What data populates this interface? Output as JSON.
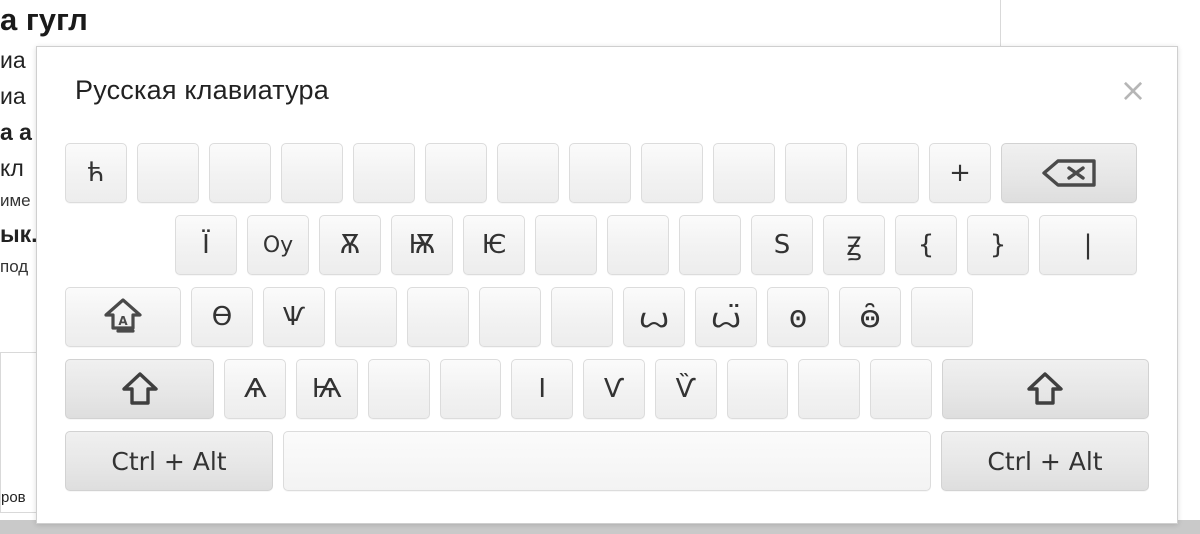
{
  "background": {
    "heading": "а гугл",
    "lines": [
      "иа",
      "иа"
    ],
    "bold_line": "а а",
    "line3": "кл",
    "line4": "имe",
    "line5": "ык.",
    "line6": "под",
    "tail": "ров",
    "links": [
      "",
      "",
      "",
      "",
      "",
      ""
    ]
  },
  "dialog": {
    "title": "Русская клавиатура",
    "close_label": "×"
  },
  "keyboard": {
    "rows": [
      {
        "name": "row-1",
        "indent": false,
        "keys": [
          {
            "label": "ћ",
            "name": "key-tshe",
            "type": "char"
          },
          {
            "label": "",
            "name": "key-blank-1",
            "type": "blank"
          },
          {
            "label": "",
            "name": "key-blank-2",
            "type": "blank"
          },
          {
            "label": "",
            "name": "key-blank-3",
            "type": "blank"
          },
          {
            "label": "",
            "name": "key-blank-4",
            "type": "blank"
          },
          {
            "label": "",
            "name": "key-blank-5",
            "type": "blank"
          },
          {
            "label": "",
            "name": "key-blank-6",
            "type": "blank"
          },
          {
            "label": "",
            "name": "key-blank-7",
            "type": "blank"
          },
          {
            "label": "",
            "name": "key-blank-8",
            "type": "blank"
          },
          {
            "label": "",
            "name": "key-blank-9",
            "type": "blank"
          },
          {
            "label": "",
            "name": "key-blank-10",
            "type": "blank"
          },
          {
            "label": "",
            "name": "key-blank-11",
            "type": "blank"
          },
          {
            "label": "+",
            "name": "key-plus",
            "type": "char"
          },
          {
            "label": "",
            "name": "key-backspace",
            "type": "backspace"
          }
        ]
      },
      {
        "name": "row-2",
        "indent": true,
        "keys": [
          {
            "label": "Ї",
            "name": "key-yi",
            "type": "char"
          },
          {
            "label": "Оу",
            "name": "key-uk-digraph",
            "type": "char-sm"
          },
          {
            "label": "Ѫ",
            "name": "key-big-yus",
            "type": "char"
          },
          {
            "label": "Ѭ",
            "name": "key-iotified-big-yus",
            "type": "char"
          },
          {
            "label": "Ѥ",
            "name": "key-iotified-e",
            "type": "char"
          },
          {
            "label": "",
            "name": "key-blank-12",
            "type": "blank"
          },
          {
            "label": "",
            "name": "key-blank-13",
            "type": "blank"
          },
          {
            "label": "",
            "name": "key-blank-14",
            "type": "blank"
          },
          {
            "label": "Ѕ",
            "name": "key-dze",
            "type": "char"
          },
          {
            "label": "Ꙃ",
            "name": "key-dzelo",
            "type": "char"
          },
          {
            "label": "{",
            "name": "key-brace-left",
            "type": "char"
          },
          {
            "label": "}",
            "name": "key-brace-right",
            "type": "char"
          },
          {
            "label": "|",
            "name": "key-pipe",
            "type": "pipe"
          }
        ]
      },
      {
        "name": "row-3",
        "indent": false,
        "keys": [
          {
            "label": "",
            "name": "key-capslock",
            "type": "capslock"
          },
          {
            "label": "Ѳ",
            "name": "key-fita",
            "type": "char"
          },
          {
            "label": "Ѱ",
            "name": "key-psi",
            "type": "char"
          },
          {
            "label": "",
            "name": "key-blank-15",
            "type": "blank"
          },
          {
            "label": "",
            "name": "key-blank-16",
            "type": "blank"
          },
          {
            "label": "",
            "name": "key-blank-17",
            "type": "blank"
          },
          {
            "label": "",
            "name": "key-blank-18",
            "type": "blank"
          },
          {
            "label": "ꙍ",
            "name": "key-broad-omega",
            "type": "char-lg"
          },
          {
            "label": "ꙍ̈",
            "name": "key-broad-omega-diaeresis",
            "type": "char-lg"
          },
          {
            "label": "ꙩ",
            "name": "key-monocular-o",
            "type": "char-lg"
          },
          {
            "label": "ꙫ̑",
            "name": "key-binocular-o",
            "type": "char-lg"
          },
          {
            "label": "",
            "name": "key-blank-19",
            "type": "blank"
          }
        ]
      },
      {
        "name": "row-4",
        "indent": false,
        "keys": [
          {
            "label": "",
            "name": "key-shift-left",
            "type": "shift-left"
          },
          {
            "label": "Ѧ",
            "name": "key-little-yus",
            "type": "char"
          },
          {
            "label": "Ѩ",
            "name": "key-iotified-little-yus",
            "type": "char"
          },
          {
            "label": "",
            "name": "key-blank-20",
            "type": "blank"
          },
          {
            "label": "",
            "name": "key-blank-21",
            "type": "blank"
          },
          {
            "label": "І",
            "name": "key-byelorussian-i",
            "type": "char"
          },
          {
            "label": "Ѵ",
            "name": "key-izhitsa",
            "type": "char"
          },
          {
            "label": "Ѷ",
            "name": "key-izhitsa-diaeresis",
            "type": "char"
          },
          {
            "label": "",
            "name": "key-blank-22",
            "type": "blank"
          },
          {
            "label": "",
            "name": "key-blank-23",
            "type": "blank"
          },
          {
            "label": "",
            "name": "key-blank-24",
            "type": "blank"
          },
          {
            "label": "",
            "name": "key-shift-right",
            "type": "shift-right"
          }
        ]
      },
      {
        "name": "row-5",
        "indent": false,
        "keys": [
          {
            "label": "Ctrl + Alt",
            "name": "key-ctrl-alt-left",
            "type": "ctrl"
          },
          {
            "label": "",
            "name": "key-space",
            "type": "space"
          },
          {
            "label": "Ctrl + Alt",
            "name": "key-ctrl-alt-right",
            "type": "ctrl"
          }
        ]
      }
    ]
  },
  "colors": {
    "key_face": "#f2f2f2",
    "key_border": "#dcdcdc",
    "mod_face": "#e6e6e6",
    "dialog_border": "#cfcfcf",
    "text": "#333333",
    "close_icon": "#b6b6b6",
    "link": "#2a2a7a"
  }
}
